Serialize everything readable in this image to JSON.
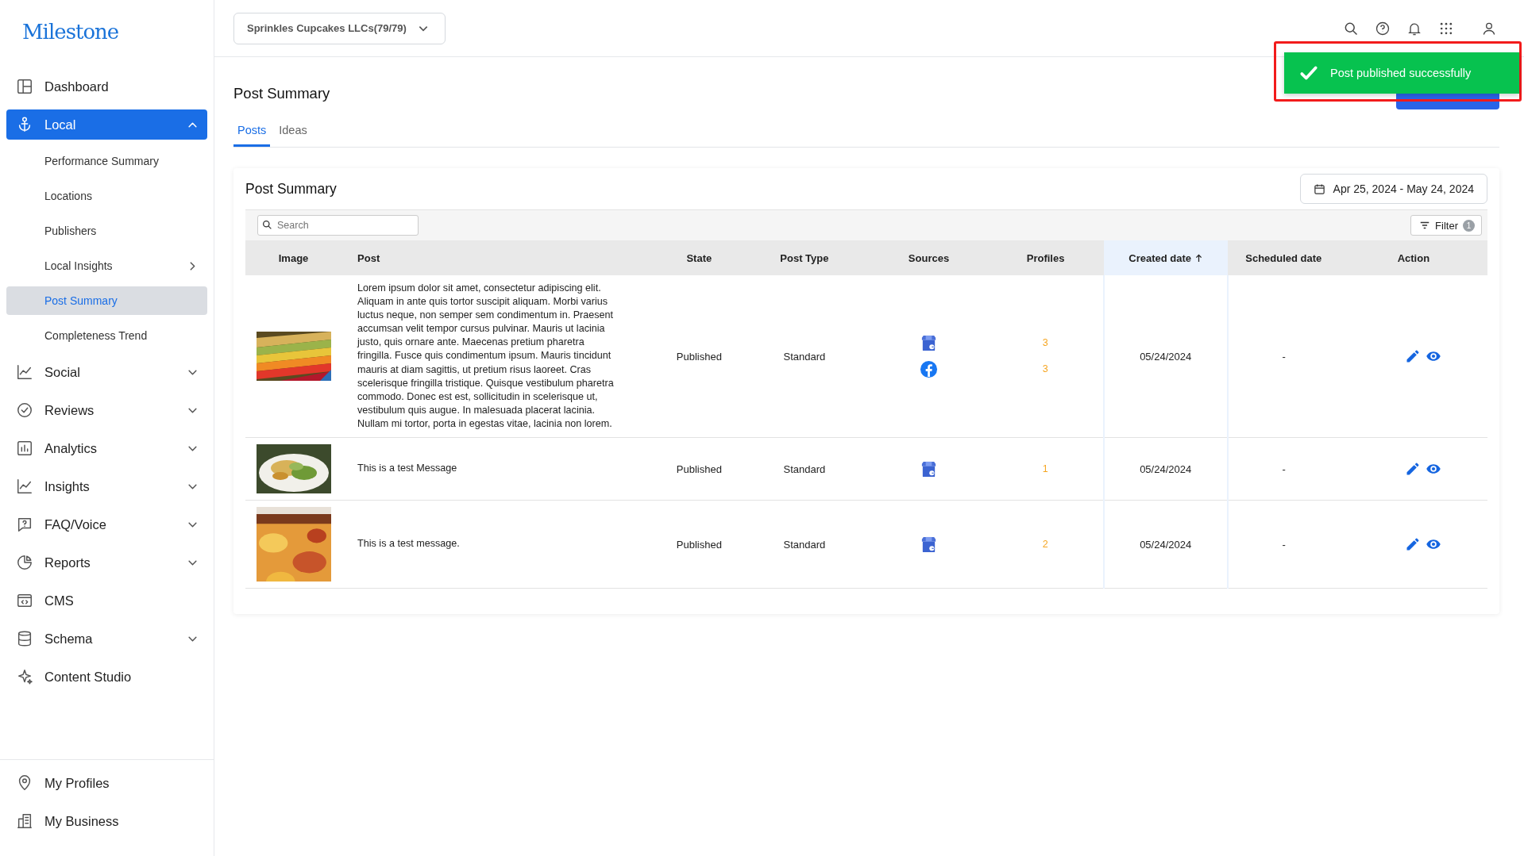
{
  "logo": "Milestone",
  "sidebar": {
    "items": [
      {
        "label": "Dashboard",
        "kind": "link",
        "selected": false
      },
      {
        "label": "Local",
        "kind": "menu",
        "selected": true,
        "expanded": true,
        "children": [
          {
            "label": "Performance Summary",
            "kind": "link",
            "selected": false
          },
          {
            "label": "Locations",
            "kind": "link",
            "selected": false
          },
          {
            "label": "Publishers",
            "kind": "link",
            "selected": false
          },
          {
            "label": "Local Insights",
            "kind": "submenu",
            "selected": false
          },
          {
            "label": "Post Summary",
            "kind": "link",
            "selected": true
          },
          {
            "label": "Completeness Trend",
            "kind": "link",
            "selected": false
          }
        ]
      },
      {
        "label": "Social",
        "kind": "menu",
        "selected": false,
        "expanded": false
      },
      {
        "label": "Reviews",
        "kind": "menu",
        "selected": false,
        "expanded": false
      },
      {
        "label": "Analytics",
        "kind": "menu",
        "selected": false,
        "expanded": false
      },
      {
        "label": "Insights",
        "kind": "menu",
        "selected": false,
        "expanded": false
      },
      {
        "label": "FAQ/Voice",
        "kind": "menu",
        "selected": false,
        "expanded": false
      },
      {
        "label": "Reports",
        "kind": "menu",
        "selected": false,
        "expanded": false
      },
      {
        "label": "CMS",
        "kind": "link",
        "selected": false
      },
      {
        "label": "Schema",
        "kind": "menu",
        "selected": false,
        "expanded": false
      },
      {
        "label": "Content Studio",
        "kind": "link",
        "selected": false
      }
    ],
    "footer_items": [
      {
        "label": "My Profiles"
      },
      {
        "label": "My Business"
      }
    ]
  },
  "topbar": {
    "account": "Sprinkles Cupcakes LLCs(79/79)"
  },
  "toast": {
    "kind": "success",
    "message": "Post published successfully",
    "highlighted": true
  },
  "page": {
    "title": "Post Summary",
    "tabs": [
      {
        "label": "Posts",
        "selected": true
      },
      {
        "label": "Ideas",
        "selected": false
      }
    ]
  },
  "card": {
    "title": "Post Summary",
    "date_range": "Apr 25, 2024 - May 24, 2024",
    "search": {
      "placeholder": "Search"
    },
    "filter": {
      "label": "Filter",
      "count": "1"
    },
    "table": {
      "columns": [
        {
          "label": "Image",
          "sorted": false
        },
        {
          "label": "Post",
          "sorted": false
        },
        {
          "label": "State",
          "sorted": false
        },
        {
          "label": "Post Type",
          "sorted": false
        },
        {
          "label": "Sources",
          "sorted": false
        },
        {
          "label": "Profiles",
          "sorted": false
        },
        {
          "label": "Created date",
          "sorted": true
        },
        {
          "label": "Scheduled date",
          "sorted": false
        },
        {
          "label": "Action",
          "sorted": false
        }
      ],
      "rows": [
        {
          "image": {
            "kind": "picture"
          },
          "post": "Lorem ipsum dolor sit amet, consectetur adipiscing elit. Aliquam in ante quis tortor suscipit aliquam. Morbi varius luctus neque, non semper sem condimentum in. Praesent accumsan velit tempor cursus pulvinar. Mauris ut lacinia justo, quis ornare ante. Maecenas pretium pharetra fringilla. Fusce quis condimentum ipsum. Mauris tincidunt mauris at diam sagittis, ut pretium risus laoreet. Cras scelerisque fringilla tristique. Quisque vestibulum pharetra commodo. Donec est est, sollicitudin in scelerisque ut, vestibulum quis augue. In malesuada placerat lacinia. Nullam mi tortor, porta in egestas vitae, lacinia non lorem.",
          "state": "Published",
          "post_type": "Standard",
          "sources": [
            {
              "kind": "google_business",
              "profiles": "3"
            },
            {
              "kind": "facebook",
              "profiles": "3"
            }
          ],
          "created_date": "05/24/2024",
          "scheduled_date": "-"
        },
        {
          "image": {
            "kind": "picture"
          },
          "post": "This is a test Message",
          "state": "Published",
          "post_type": "Standard",
          "sources": [
            {
              "kind": "google_business",
              "profiles": "1"
            }
          ],
          "created_date": "05/24/2024",
          "scheduled_date": "-"
        },
        {
          "image": {
            "kind": "picture"
          },
          "post": "This is a test message.",
          "state": "Published",
          "post_type": "Standard",
          "sources": [
            {
              "kind": "google_business",
              "profiles": "2"
            }
          ],
          "created_date": "05/24/2024",
          "scheduled_date": "-"
        }
      ]
    }
  }
}
